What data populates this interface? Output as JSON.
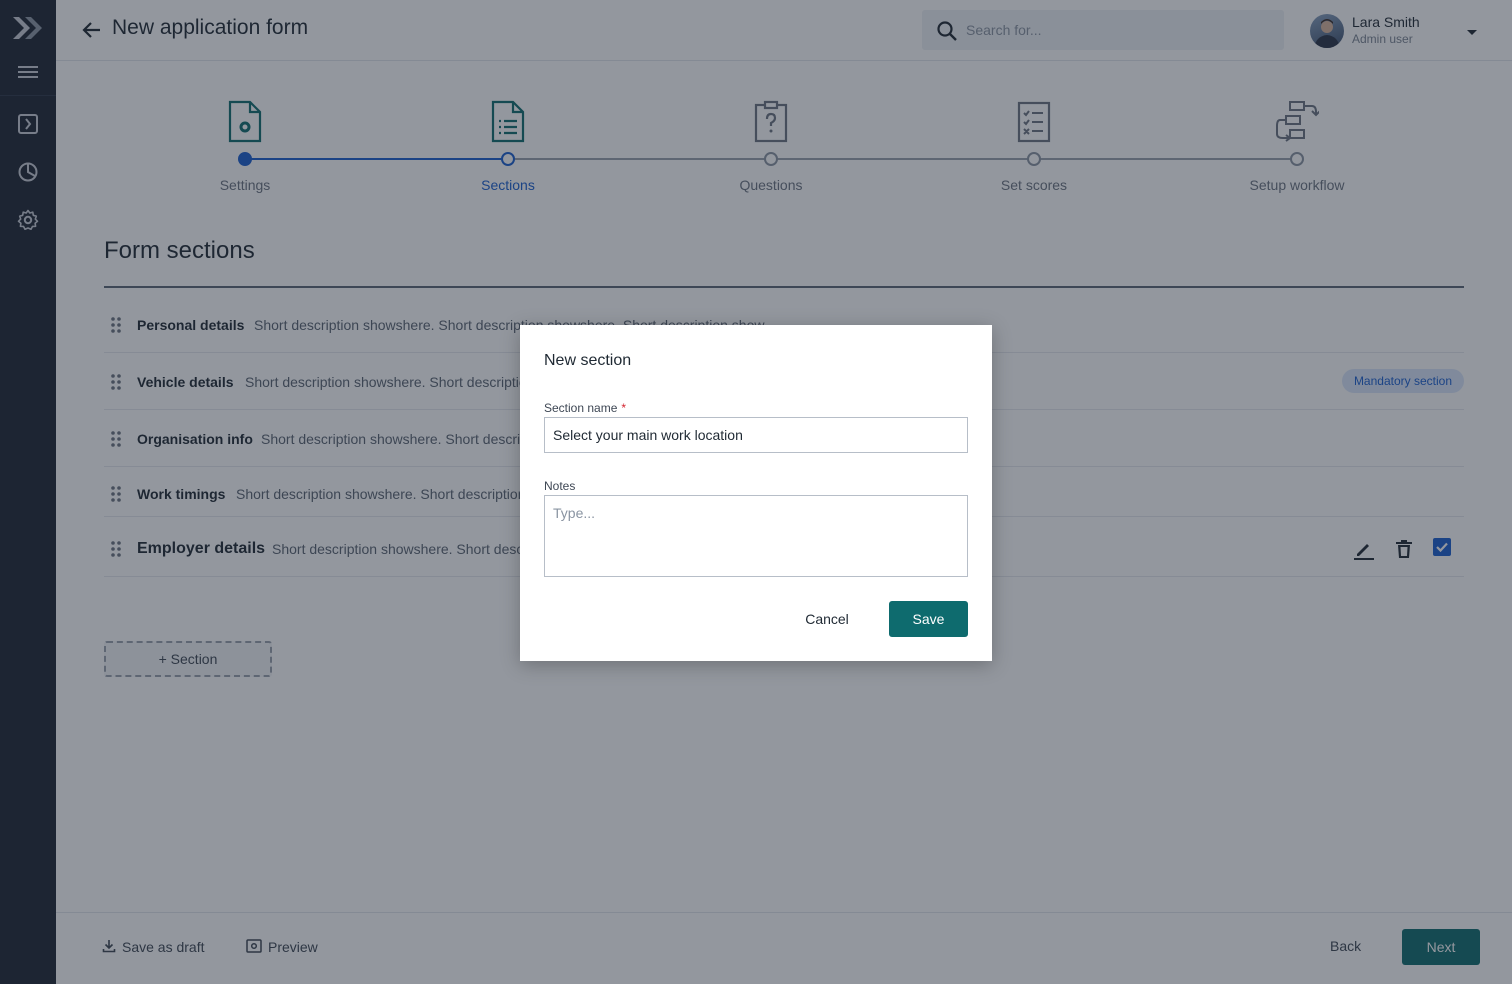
{
  "app": {
    "logo_icon": "logo-icon",
    "accent_color": "#0e6b6e",
    "primary_blue": "#1a5fd0"
  },
  "sidebar": {
    "items": [
      {
        "name": "menu-icon"
      },
      {
        "name": "forms-icon"
      },
      {
        "name": "reports-icon"
      },
      {
        "name": "settings-icon"
      }
    ]
  },
  "header": {
    "title": "New application form",
    "search_placeholder": "Search for...",
    "user_name": "Lara Smith",
    "user_role": "Admin user"
  },
  "stepper": {
    "steps": [
      {
        "label": "Settings",
        "state": "done",
        "icon": "document-gear-icon"
      },
      {
        "label": "Sections",
        "state": "active",
        "icon": "document-list-icon"
      },
      {
        "label": "Questions",
        "state": "upcoming",
        "icon": "clipboard-question-icon"
      },
      {
        "label": "Set scores",
        "state": "upcoming",
        "icon": "checklist-icon"
      },
      {
        "label": "Setup workflow",
        "state": "upcoming",
        "icon": "workflow-icon"
      }
    ]
  },
  "sections": {
    "title": "Form sections",
    "rows": [
      {
        "name": "Personal details",
        "description": "Short description showshere. Short description showshere. Short description show"
      },
      {
        "name": "Vehicle details",
        "description": "Short description showshere. Short description",
        "badge": "Mandatory section"
      },
      {
        "name": "Organisation info",
        "description": "Short description showshere. Short description"
      },
      {
        "name": "Work timings",
        "description": "Short description showshere. Short description"
      },
      {
        "name": "Employer details",
        "description": "Short description showshere. Short description"
      }
    ],
    "add_label": "+ Section"
  },
  "footer": {
    "save_draft": "Save as draft",
    "preview": "Preview",
    "back": "Back",
    "next": "Next"
  },
  "dialog": {
    "title": "New section",
    "name_label": "Section name",
    "required_mark": "*",
    "name_value": "Select your main work location",
    "notes_label": "Notes",
    "notes_placeholder": "Type...",
    "cancel": "Cancel",
    "save": "Save"
  }
}
